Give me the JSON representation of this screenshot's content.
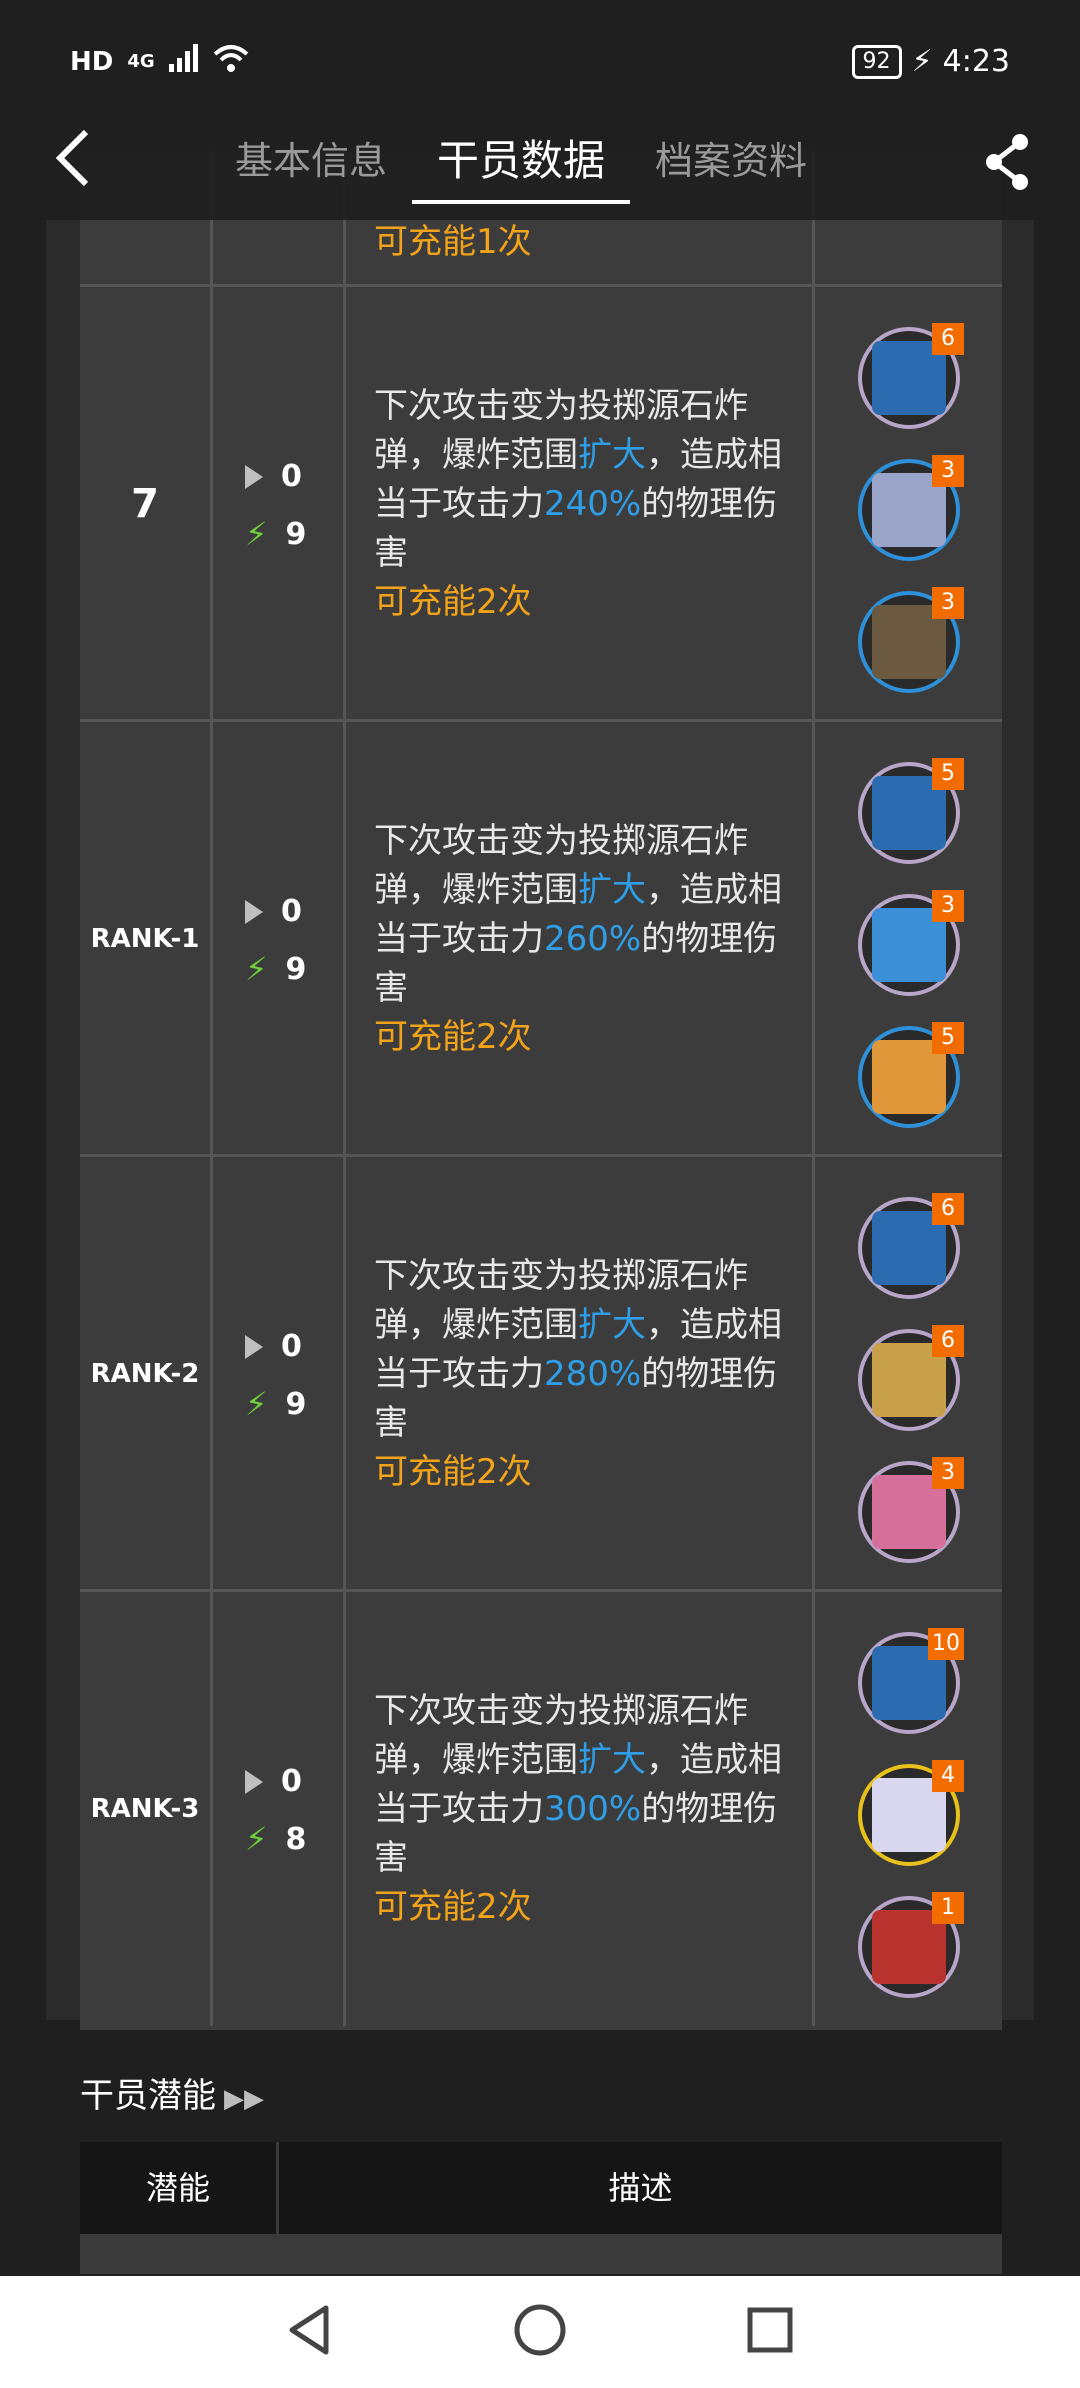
{
  "status_bar": {
    "left": [
      "HD",
      "4G"
    ],
    "battery": "92",
    "time": "4:23"
  },
  "header": {
    "tabs": [
      {
        "label": "基本信息",
        "active": false
      },
      {
        "label": "干员数据",
        "active": true
      },
      {
        "label": "档案资料",
        "active": false
      }
    ]
  },
  "skill_table": {
    "partial_top_row": {
      "charge_text": "可充能1次"
    },
    "rows": [
      {
        "level": "7",
        "initial_sp": "0",
        "sp_cost": "9",
        "desc_pre": "下次攻击变为投掷源石炸弹，爆炸范围",
        "desc_hl1": "扩大",
        "desc_mid": "，造成相当于攻击力",
        "desc_hl2": "240%",
        "desc_post": "的物理伤害",
        "charge": "可充能2次",
        "materials": [
          {
            "icon": "skill-summary-book-icon",
            "qty": "6",
            "color": "#2b6cb0",
            "rim": "#b8a6c9"
          },
          {
            "icon": "device-material-icon",
            "qty": "3",
            "color": "#9aa4c8",
            "rim": "#2e90d8"
          },
          {
            "icon": "ore-material-icon",
            "qty": "3",
            "color": "#6b5a40",
            "rim": "#2e90d8"
          }
        ]
      },
      {
        "level": "RANK-1",
        "initial_sp": "0",
        "sp_cost": "9",
        "desc_pre": "下次攻击变为投掷源石炸弹，爆炸范围",
        "desc_hl1": "扩大",
        "desc_mid": "，造成相当于攻击力",
        "desc_hl2": "260%",
        "desc_post": "的物理伤害",
        "charge": "可充能2次",
        "materials": [
          {
            "icon": "skill-summary-book-icon",
            "qty": "5",
            "color": "#2b6cb0",
            "rim": "#b8a6c9"
          },
          {
            "icon": "crystal-material-icon",
            "qty": "3",
            "color": "#3a8fd6",
            "rim": "#b8a6c9"
          },
          {
            "icon": "bread-material-icon",
            "qty": "5",
            "color": "#e0973a",
            "rim": "#2e90d8"
          }
        ]
      },
      {
        "level": "RANK-2",
        "initial_sp": "0",
        "sp_cost": "9",
        "desc_pre": "下次攻击变为投掷源石炸弹，爆炸范围",
        "desc_hl1": "扩大",
        "desc_mid": "，造成相当于攻击力",
        "desc_hl2": "280%",
        "desc_post": "的物理伤害",
        "charge": "可充能2次",
        "materials": [
          {
            "icon": "skill-summary-book-icon",
            "qty": "6",
            "color": "#2b6cb0",
            "rim": "#b8a6c9"
          },
          {
            "icon": "gold-device-material-icon",
            "qty": "6",
            "color": "#c9a04a",
            "rim": "#b8a6c9"
          },
          {
            "icon": "pink-device-material-icon",
            "qty": "3",
            "color": "#d6709a",
            "rim": "#b8a6c9"
          }
        ]
      },
      {
        "level": "RANK-3",
        "initial_sp": "0",
        "sp_cost": "8",
        "desc_pre": "下次攻击变为投掷源石炸弹，爆炸范围",
        "desc_hl1": "扩大",
        "desc_mid": "，造成相当于攻击力",
        "desc_hl2": "300%",
        "desc_post": "的物理伤害",
        "charge": "可充能2次",
        "materials": [
          {
            "icon": "skill-summary-book-icon",
            "qty": "10",
            "color": "#2b6cb0",
            "rim": "#b8a6c9"
          },
          {
            "icon": "white-crystal-material-icon",
            "qty": "4",
            "color": "#d9d6ef",
            "rim": "#e8c21a"
          },
          {
            "icon": "red-crystal-material-icon",
            "qty": "1",
            "color": "#b8322e",
            "rim": "#b8a6c9"
          }
        ]
      }
    ]
  },
  "potential": {
    "title": "干员潜能",
    "headers": [
      "潜能",
      "描述"
    ]
  },
  "colors": {
    "highlight": "#2f9ee6",
    "charge": "#f2a31a",
    "sp_icon": "#6fcf3a",
    "qty_badge": "#f26c00"
  }
}
